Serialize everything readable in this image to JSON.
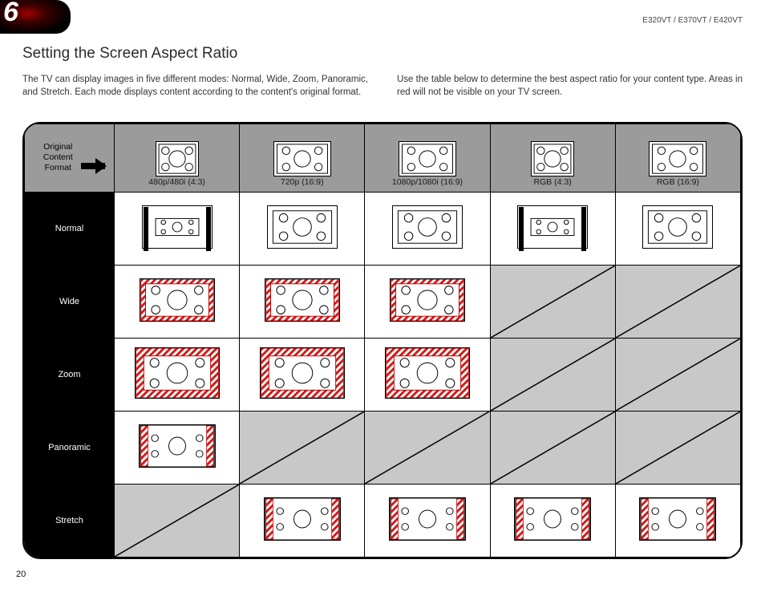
{
  "chapter_number": "6",
  "models": "E320VT / E370VT / E420VT",
  "heading": "Setting the Screen Aspect Ratio",
  "intro_left": "The TV can display images in five different modes: Normal, Wide, Zoom, Panoramic, and Stretch. Each mode displays content according to the content's original format.",
  "intro_right": "Use the table below to determine the best aspect ratio for your content type. Areas in red will not be visible on your TV screen.",
  "corner_label": "Original\nContent\nFormat",
  "columns": [
    "480p/480i (4:3)",
    "720p (16:9)",
    "1080p/1080i (16:9)",
    "RGB (4:3)",
    "RGB (16:9)"
  ],
  "rows": [
    "Normal",
    "Wide",
    "Zoom",
    "Panoramic",
    "Stretch"
  ],
  "page_number": "20",
  "chart_data": {
    "type": "table",
    "title": "Aspect ratio availability and overscan by input format",
    "columns": [
      "480p/480i (4:3)",
      "720p (16:9)",
      "1080p/1080i (16:9)",
      "RGB (4:3)",
      "RGB (16:9)"
    ],
    "rows": [
      "Normal",
      "Wide",
      "Zoom",
      "Panoramic",
      "Stretch"
    ],
    "cells": {
      "Normal": [
        "pillarboxed",
        "full-no-crop",
        "full-no-crop",
        "pillarboxed",
        "full-no-crop"
      ],
      "Wide": [
        "crop-all-edges",
        "crop-all-edges",
        "crop-all-edges",
        "unavailable",
        "unavailable"
      ],
      "Zoom": [
        "crop-all-edges-more",
        "crop-all-edges-more",
        "crop-all-edges-more",
        "unavailable",
        "unavailable"
      ],
      "Panoramic": [
        "crop-left-right",
        "unavailable",
        "unavailable",
        "unavailable",
        "unavailable"
      ],
      "Stretch": [
        "unavailable",
        "crop-left-right",
        "crop-left-right",
        "crop-left-right",
        "crop-left-right"
      ]
    }
  }
}
